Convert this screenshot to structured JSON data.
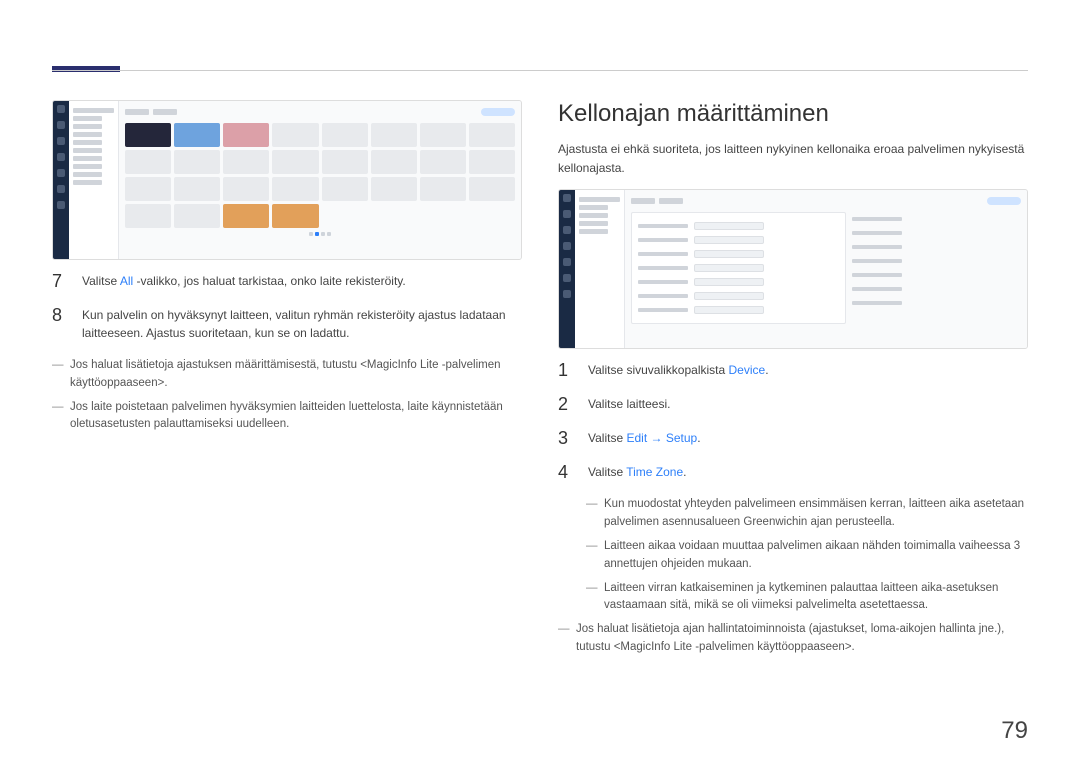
{
  "page_number": "79",
  "left": {
    "steps": [
      {
        "num": "7",
        "pre": "Valitse ",
        "link": "All",
        "post": " -valikko, jos haluat tarkistaa, onko laite rekisteröity."
      },
      {
        "num": "8",
        "pre": "Kun palvelin on hyväksynyt laitteen, valitun ryhmän rekisteröity ajastus ladataan laitteeseen. Ajastus suoritetaan, kun se on ladattu.",
        "link": "",
        "post": ""
      }
    ],
    "notes": [
      "Jos haluat lisätietoja ajastuksen määrittämisestä, tutustu <MagicInfo Lite -palvelimen käyttöoppaaseen>.",
      "Jos laite poistetaan palvelimen hyväksymien laitteiden luettelosta, laite käynnistetään oletusasetusten palauttamiseksi uudelleen."
    ]
  },
  "right": {
    "title": "Kellonajan määrittäminen",
    "intro": "Ajastusta ei ehkä suoriteta, jos laitteen nykyinen kellonaika eroaa palvelimen nykyisestä kellonajasta.",
    "steps": [
      {
        "num": "1",
        "pre": "Valitse sivuvalikkopalkista ",
        "link": "Device",
        "post": "."
      },
      {
        "num": "2",
        "pre": "Valitse laitteesi.",
        "link": "",
        "post": ""
      },
      {
        "num": "3",
        "pre": "Valitse ",
        "link": "Edit",
        "arrow": " → ",
        "link2": "Setup",
        "post": "."
      },
      {
        "num": "4",
        "pre": "Valitse ",
        "link": "Time Zone",
        "post": "."
      }
    ],
    "subnotes": [
      "Kun muodostat yhteyden palvelimeen ensimmäisen kerran, laitteen aika asetetaan palvelimen asennusalueen Greenwichin ajan perusteella.",
      "Laitteen aikaa voidaan muuttaa palvelimen aikaan nähden toimimalla vaiheessa 3 annettujen ohjeiden mukaan.",
      "Laitteen virran katkaiseminen ja kytkeminen palauttaa laitteen aika-asetuksen vastaamaan sitä, mikä se oli viimeksi palvelimelta asetettaessa."
    ],
    "endnote": "Jos haluat lisätietoja ajan hallintatoiminnoista (ajastukset, loma-aikojen hallinta jne.), tutustu <MagicInfo Lite -palvelimen käyttöoppaaseen>."
  }
}
